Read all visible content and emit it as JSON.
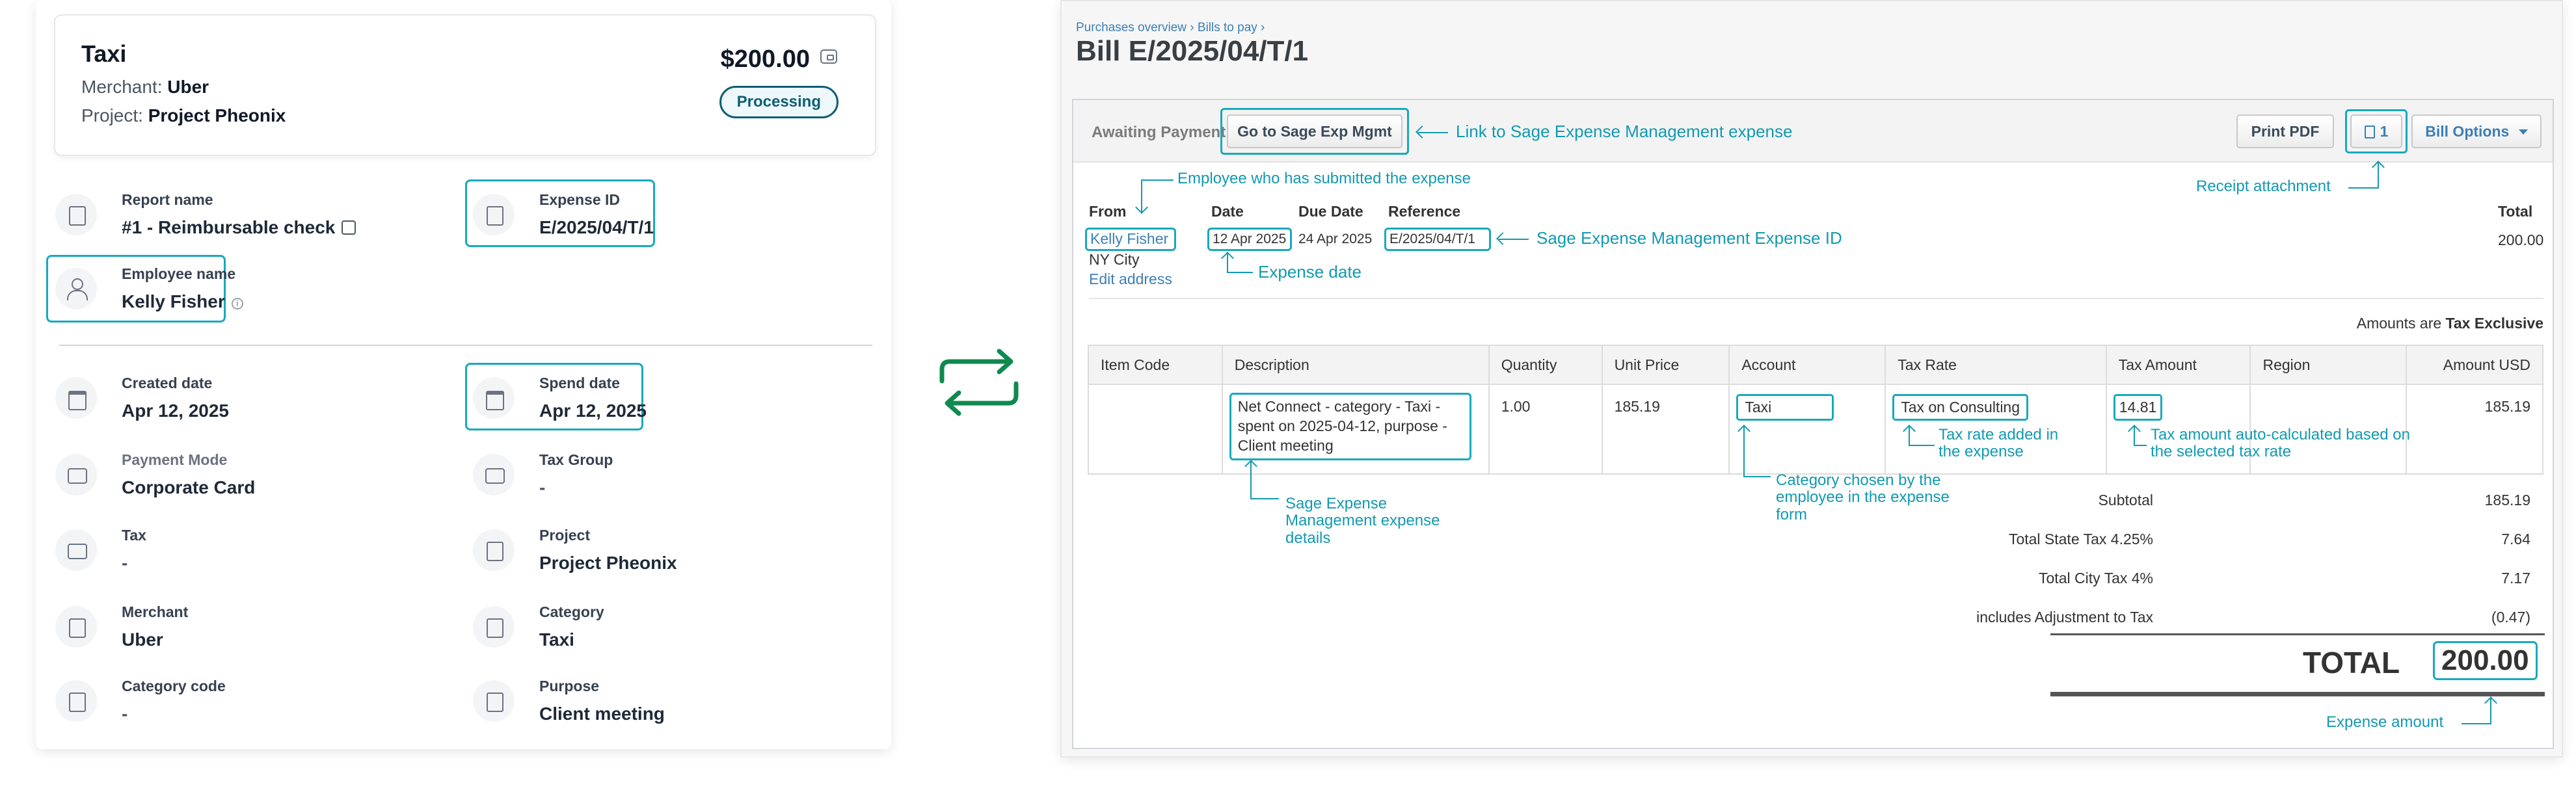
{
  "expense": {
    "title": "Taxi",
    "merchant_label": "Merchant:",
    "merchant": "Uber",
    "project_label": "Project:",
    "project": "Project Pheonix",
    "amount": "$200.00",
    "status": "Processing"
  },
  "fields": {
    "report_name_label": "Report name",
    "report_name": "#1 - Reimbursable check",
    "expense_id_label": "Expense ID",
    "expense_id": "E/2025/04/T/1",
    "employee_name_label": "Employee name",
    "employee_name": "Kelly Fisher",
    "created_date_label": "Created date",
    "created_date": "Apr 12, 2025",
    "spend_date_label": "Spend date",
    "spend_date": "Apr 12, 2025",
    "payment_mode_label": "Payment Mode",
    "payment_mode": "Corporate Card",
    "tax_group_label": "Tax Group",
    "tax_group": "-",
    "tax_label": "Tax",
    "tax": "-",
    "project_label": "Project",
    "project": "Project Pheonix",
    "merchant_label": "Merchant",
    "merchant": "Uber",
    "category_label": "Category",
    "category": "Taxi",
    "category_code_label": "Category code",
    "category_code": "-",
    "purpose_label": "Purpose",
    "purpose": "Client meeting"
  },
  "bill": {
    "breadcrumb": "Purchases overview › Bills to pay ›",
    "title": "Bill E/2025/04/T/1",
    "status": "Awaiting Payment",
    "sage_button": "Go to Sage Exp Mgmt",
    "print_pdf": "Print PDF",
    "attachment_count": "1",
    "bill_options": "Bill Options",
    "from_label": "From",
    "date_label": "Date",
    "due_date_label": "Due Date",
    "reference_label": "Reference",
    "total_label": "Total",
    "from_name": "Kelly Fisher",
    "city": "NY City",
    "edit_address": "Edit address",
    "date": "12 Apr 2025",
    "due_date": "24 Apr 2025",
    "reference": "E/2025/04/T/1",
    "total": "200.00",
    "amounts_are_prefix": "Amounts are",
    "amounts_are_value": "Tax Exclusive",
    "columns": [
      "Item Code",
      "Description",
      "Quantity",
      "Unit Price",
      "Account",
      "Tax Rate",
      "Tax Amount",
      "Region",
      "Amount USD"
    ],
    "row": {
      "item_code": "",
      "description": "Net Connect - category - Taxi - spent on 2025-04-12, purpose - Client meeting",
      "quantity": "1.00",
      "unit_price": "185.19",
      "account": "Taxi",
      "tax_rate": "Tax on Consulting",
      "tax_amount": "14.81",
      "region": "",
      "amount": "185.19"
    },
    "subtotal_label": "Subtotal",
    "subtotal": "185.19",
    "state_tax_label": "Total State Tax 4.25%",
    "state_tax": "7.64",
    "city_tax_label": "Total City Tax 4%",
    "city_tax": "7.17",
    "adjustment_label": "includes Adjustment to Tax",
    "adjustment": "(0.47)",
    "grand_total_label": "TOTAL",
    "grand_total": "200.00"
  },
  "annotations": {
    "sage_link": "Link to Sage Expense Management expense",
    "receipt": "Receipt attachment",
    "employee": "Employee who has submitted the expense",
    "expense_id": "Sage Expense Management Expense ID",
    "expense_date": "Expense date",
    "details": "Sage Expense Management expense details",
    "category": "Category chosen by the employee in the expense form",
    "tax_rate": "Tax rate added in the expense",
    "tax_amount": "Tax amount auto-calculated based on the selected tax rate",
    "amount": "Expense amount"
  },
  "colors": {
    "accent": "#18a9bd",
    "annotation": "#129ab0",
    "status": "#0e5e73",
    "sync_arrows": "#0f8a4f",
    "link": "#3b7fb6"
  }
}
